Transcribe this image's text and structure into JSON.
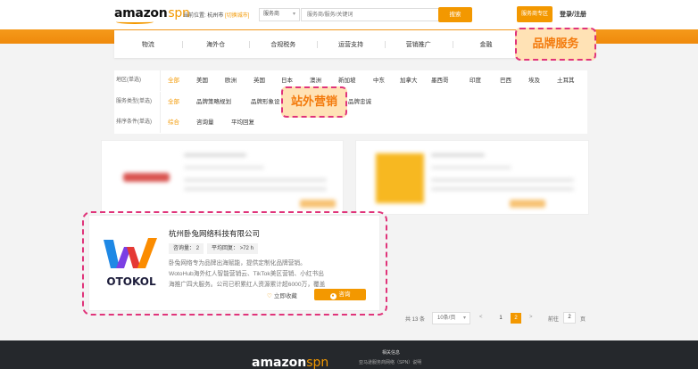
{
  "header": {
    "logo_main": "amazon",
    "logo_sub": "spn",
    "location_label": "当前位置:",
    "location_city": "杭州市",
    "location_switch": "[切换城市]",
    "search_select": "服务商",
    "search_placeholder": "服务商/服务/关键词",
    "search_button": "搜索",
    "zone_button": "服务商专区",
    "login": "登录/注册"
  },
  "nav": {
    "items": [
      "物流",
      "海外仓",
      "合规税务",
      "运营支持",
      "营销推广",
      "金融",
      "品牌服务"
    ]
  },
  "callouts": {
    "brand": "品牌服务",
    "station": "站外营销"
  },
  "filters": {
    "region_label": "地区(单选)",
    "regions": [
      "全部",
      "美国",
      "欧洲",
      "英国",
      "日本",
      "澳洲",
      "新加坡",
      "中东",
      "加拿大",
      "墨西哥",
      "印度",
      "巴西",
      "埃及",
      "土耳其"
    ],
    "service_label": "服务类型(单选)",
    "services": [
      "全部",
      "品牌策略规划",
      "品牌形象设",
      "站外营销",
      "品牌忠诚"
    ],
    "sort_label": "排序条件(单选)",
    "sorts": [
      "综合",
      "咨询量",
      "平均回复"
    ]
  },
  "card": {
    "company": "杭州卧兔网络科技有限公司",
    "logo_text": "OTOKOL",
    "inquiries_label": "咨询量：",
    "inquiries_value": "2",
    "reply_label": "平均回复：",
    "reply_value": ">72 h",
    "description": "卧兔网络专为品牌出海赋能，提供定制化品牌营销。WotoHub海外红人智能营销云、TikTok美区营销、小红书出海推广四大服务。公司已积累红人资源累计超6000万，覆盖150多个国...",
    "favorite": "立即收藏",
    "consult": "咨询"
  },
  "pager": {
    "total": "共 13 条",
    "page_size": "10条/页",
    "prev": "<",
    "pages": [
      "1",
      "2"
    ],
    "current": "2",
    "next": ">",
    "goto_label": "前往",
    "goto_value": "2",
    "goto_unit": "页"
  },
  "footer": {
    "logo_main": "amazon",
    "logo_sub": "spn",
    "title": "相关信息",
    "link": "亚马逊服务商网络（SPN）说明"
  },
  "colors": {
    "accent": "#f39800",
    "highlight_border": "#e0347a",
    "callout_bg": "#ffe2b5"
  }
}
